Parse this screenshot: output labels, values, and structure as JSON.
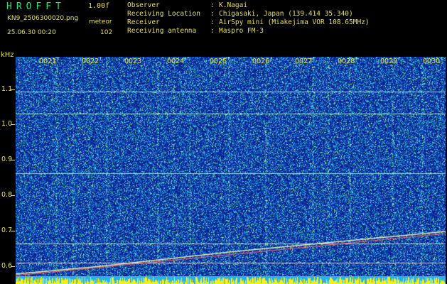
{
  "header": {
    "app_title": "HROFFT",
    "version": "1.00f",
    "file_name": "KN9_2506300020.png",
    "mode": "meteor",
    "datetime": "25.06.30 00:20",
    "count": "102"
  },
  "meta": [
    {
      "key": "Observer",
      "value": "K.Nagai"
    },
    {
      "key": "Receiving Location",
      "value": "Chigasaki, Japan (139.414 35.340)"
    },
    {
      "key": "Receiver",
      "value": "AirSpy mini (Miakejima VOR 108.65MHz)"
    },
    {
      "key": "Receiving antenna",
      "value": "Maspro FM-3"
    }
  ],
  "spectrogram": {
    "freq_unit": "kHz",
    "freq_ticks": [
      "1.1",
      "1.0",
      "0.9",
      "0.8",
      "0.7",
      "0.6"
    ],
    "time_labels": [
      "0021",
      "0022",
      "0023",
      "0024",
      "0025",
      "0026",
      "0027",
      "0028",
      "0029",
      "0030"
    ],
    "colors": {
      "background": "#0a1e8c",
      "text": "#e8e04a",
      "title": "#2ee07a"
    }
  }
}
